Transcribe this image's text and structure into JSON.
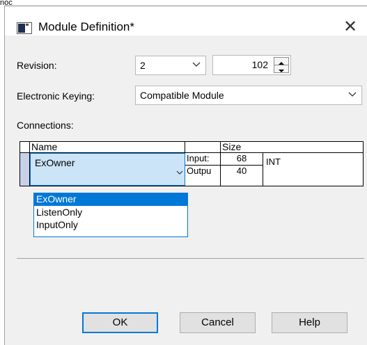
{
  "background_fragment": "noc",
  "dialog": {
    "title": "Module Definition*",
    "close_symbol": "✕"
  },
  "revision": {
    "label": "Revision:",
    "major": "2",
    "minor": "102"
  },
  "keying": {
    "label": "Electronic Keying:",
    "value": "Compatible Module"
  },
  "connections": {
    "label": "Connections:",
    "headers": {
      "name": "Name",
      "size": "Size"
    },
    "row": {
      "name": "ExOwner",
      "input_label": "Input:",
      "input_size": "68",
      "output_label": "Outpu",
      "output_size": "40",
      "type": "INT"
    },
    "dropdown_options": [
      "ExOwner",
      "ListenOnly",
      "InputOnly"
    ],
    "selected_option": "ExOwner"
  },
  "buttons": {
    "ok": "OK",
    "cancel": "Cancel",
    "help": "Help"
  },
  "colors": {
    "accent": "#0078d7",
    "selection_bg": "#cce4f7",
    "dialog_bg": "#f0f0f0"
  }
}
